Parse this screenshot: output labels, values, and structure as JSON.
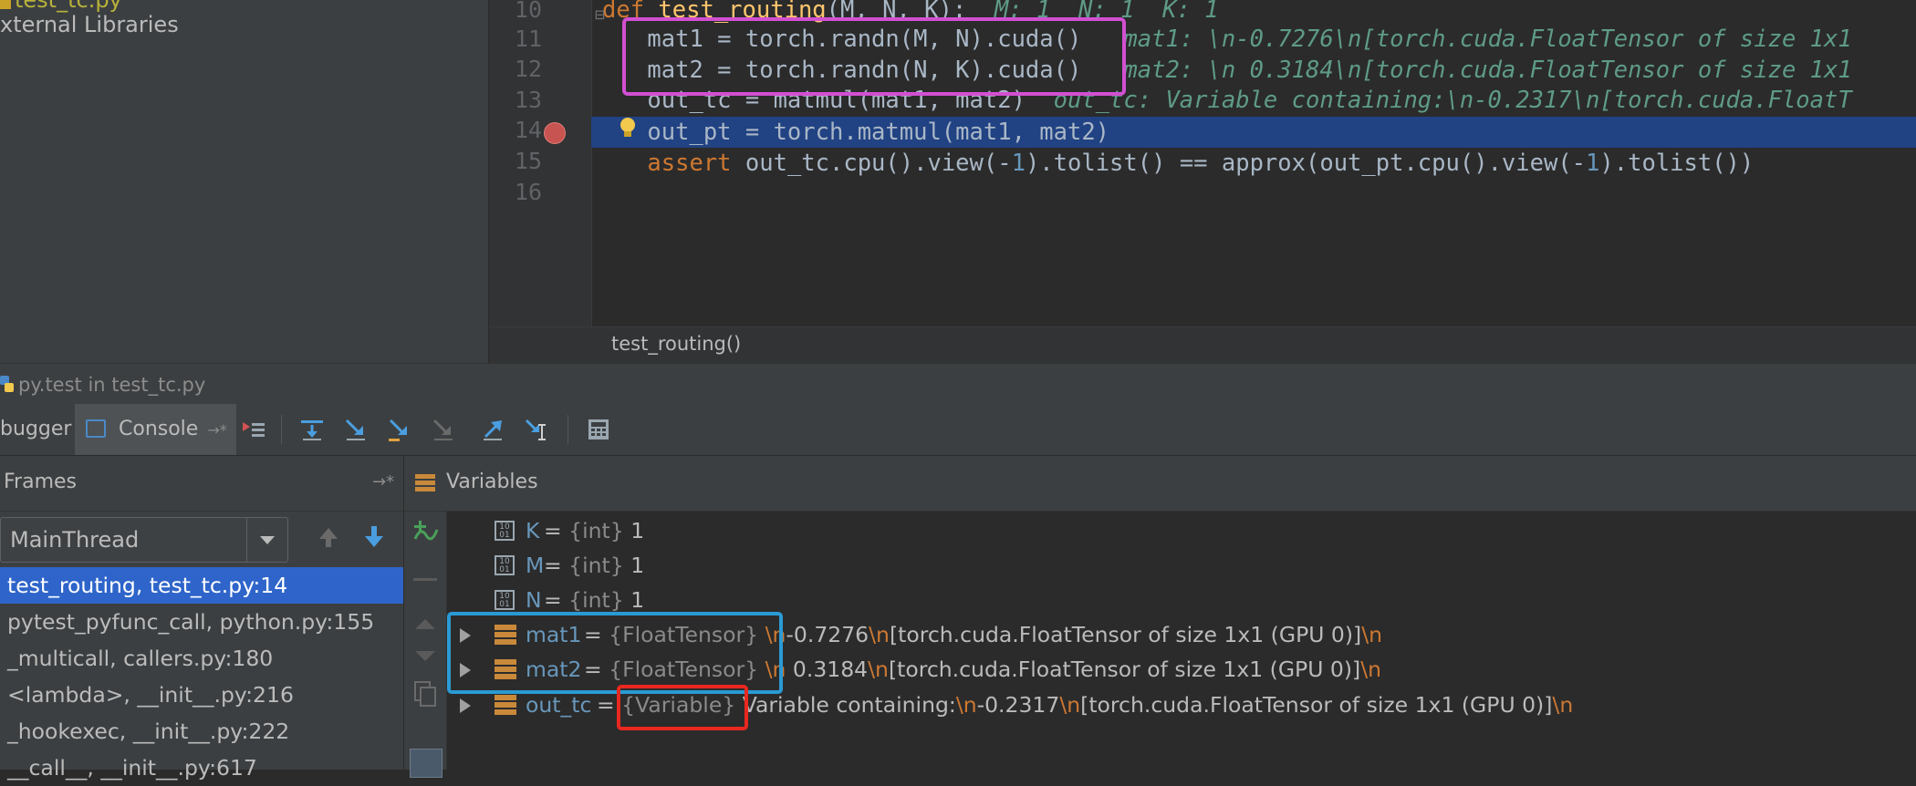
{
  "project_tree": {
    "items": [
      {
        "label": "test_tc.py"
      },
      {
        "label": "xternal Libraries"
      }
    ]
  },
  "editor": {
    "lines": [
      {
        "num": "10"
      },
      {
        "num": "11"
      },
      {
        "num": "12"
      },
      {
        "num": "13"
      },
      {
        "num": "14"
      },
      {
        "num": "15"
      },
      {
        "num": "16"
      }
    ],
    "code": {
      "l10_kw": "def",
      "l10_fn": "test_routing",
      "l10_rest": "(M, N, K):",
      "l10_hint": "M: 1  N: 1  K: 1",
      "l11": "    mat1 = torch.randn(M, N).cuda()",
      "l11_hint": "mat1: \\n-0.7276\\n[torch.cuda.FloatTensor of size 1x1",
      "l12": "    mat2 = torch.randn(N, K).cuda()",
      "l12_hint": "mat2: \\n 0.3184\\n[torch.cuda.FloatTensor of size 1x1",
      "l13": "    out_tc = matmul(mat1, mat2)",
      "l13_hint": "out_tc: Variable containing:\\n-0.2317\\n[torch.cuda.FloatT",
      "l14": "    out_pt = torch.matmul(mat1, mat2)",
      "l15_kw": "    assert",
      "l15_a": " out_tc.cpu().view(-",
      "l15_n1": "1",
      "l15_b": ").tolist() == approx(out_pt.cpu().view(-",
      "l15_n2": "1",
      "l15_c": ").tolist())"
    },
    "breadcrumb": "test_routing()"
  },
  "tool_window": {
    "title": "py.test in test_tc.py"
  },
  "debug_toolbar": {
    "tab_debugger": "bugger",
    "tab_console": "Console"
  },
  "frames": {
    "header": "Frames",
    "thread": "MainThread",
    "items": [
      {
        "label": "test_routing, test_tc.py:14"
      },
      {
        "label": "pytest_pyfunc_call, python.py:155"
      },
      {
        "label": "_multicall, callers.py:180"
      },
      {
        "label": "<lambda>, __init__.py:216"
      },
      {
        "label": "_hookexec, __init__.py:222"
      },
      {
        "label": "__call__, __init__.py:617"
      }
    ]
  },
  "variables": {
    "header": "Variables",
    "items": [
      {
        "name": "K",
        "eq": " = ",
        "type": "{int}",
        "value": " 1"
      },
      {
        "name": "M",
        "eq": " = ",
        "type": "{int}",
        "value": " 1"
      },
      {
        "name": "N",
        "eq": " = ",
        "type": "{int}",
        "value": " 1"
      },
      {
        "name": "mat1",
        "eq": " = ",
        "type": "{FloatTensor}",
        "v1": " ",
        "nl1": "\\n",
        "v2": "-0.7276",
        "nl2": "\\n",
        "v3": "[torch.cuda.FloatTensor of size 1x1 (GPU 0)]",
        "nl3": "\\n"
      },
      {
        "name": "mat2",
        "eq": " = ",
        "type": "{FloatTensor}",
        "v1": " ",
        "nl1": "\\n",
        "v2": " 0.3184",
        "nl2": "\\n",
        "v3": "[torch.cuda.FloatTensor of size 1x1 (GPU 0)]",
        "nl3": "\\n"
      },
      {
        "name": "out_tc",
        "eq": " = ",
        "type": "{Variable}",
        "v1": " Variable containing:",
        "nl1": "\\n",
        "v2": "-0.2317",
        "nl2": "\\n",
        "v3": "[torch.cuda.FloatTensor of size 1x1 (GPU 0)]",
        "nl3": "\\n"
      }
    ]
  },
  "colors": {
    "highlight_pink": "#d34fd2",
    "highlight_blue": "#2a9ad4",
    "highlight_red": "#e8281f",
    "selected_frame": "#2f65ca",
    "exec_line": "#214283"
  }
}
